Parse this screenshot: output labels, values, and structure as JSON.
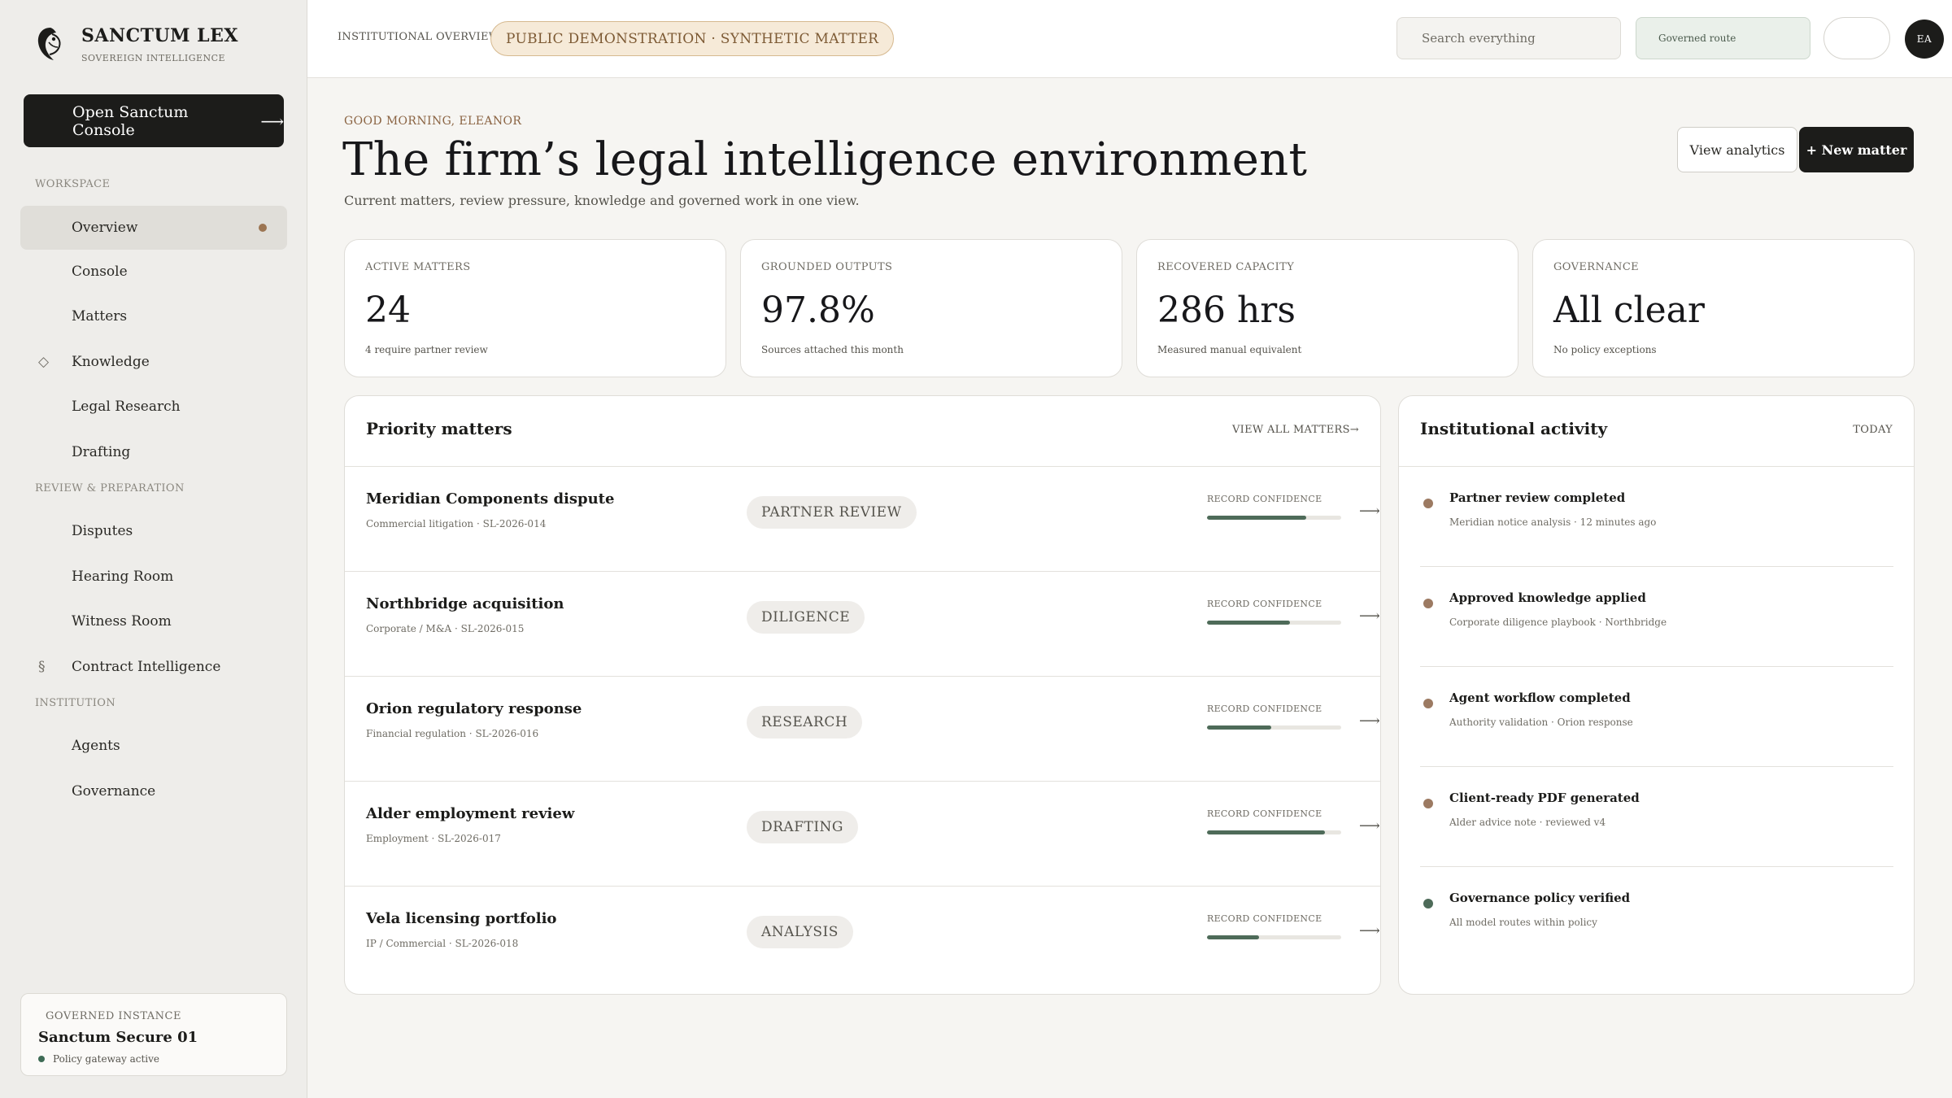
{
  "brand": {
    "name": "SANCTUM LEX",
    "tagline": "SOVEREIGN INTELLIGENCE"
  },
  "console_button": {
    "label": "Open Sanctum Console",
    "icon": "arrow-right-icon"
  },
  "sidebar": {
    "sections": [
      {
        "label": "WORKSPACE"
      },
      {
        "label": "REVIEW & PREPARATION"
      },
      {
        "label": "INSTITUTION"
      }
    ],
    "items": [
      {
        "label": "Overview",
        "active": true
      },
      {
        "label": "Console"
      },
      {
        "label": "Matters"
      },
      {
        "label": "Knowledge",
        "icon": "diamond-icon",
        "glyph": "◇"
      },
      {
        "label": "Legal Research"
      },
      {
        "label": "Drafting"
      },
      {
        "label": "Disputes"
      },
      {
        "label": "Hearing Room"
      },
      {
        "label": "Witness Room"
      },
      {
        "label": "Contract Intelligence",
        "icon": "section-sign-icon",
        "glyph": "§"
      },
      {
        "label": "Agents"
      },
      {
        "label": "Governance"
      }
    ]
  },
  "instance": {
    "label": "GOVERNED INSTANCE",
    "name": "Sanctum Secure 01",
    "status": "Policy gateway active"
  },
  "topbar": {
    "breadcrumb": "INSTITUTIONAL OVERVIEW",
    "demo_pill": "PUBLIC DEMONSTRATION · SYNTHETIC MATTER",
    "search_placeholder": "Search everything",
    "route_label": "Governed route",
    "avatar_initials": "EA"
  },
  "header": {
    "greeting": "GOOD MORNING, ELEANOR",
    "title": "The firm’s legal intelligence environment",
    "subtitle": "Current matters, review pressure, knowledge and governed work in one view.",
    "analytics_button": "View analytics",
    "new_matter_button": "+ New matter"
  },
  "stats": [
    {
      "label": "ACTIVE MATTERS",
      "value": "24",
      "note": "4 require partner review"
    },
    {
      "label": "GROUNDED OUTPUTS",
      "value": "97.8%",
      "note": "Sources attached this month"
    },
    {
      "label": "RECOVERED CAPACITY",
      "value": "286 hrs",
      "note": "Measured manual equivalent"
    },
    {
      "label": "GOVERNANCE",
      "value": "All clear",
      "note": "No policy exceptions"
    }
  ],
  "priority": {
    "title": "Priority matters",
    "link": "VIEW ALL MATTERS→",
    "confidence_label": "RECORD CONFIDENCE",
    "matters": [
      {
        "name": "Meridian Components dispute",
        "meta": "Commercial litigation · SL-2026-014",
        "status": "PARTNER REVIEW",
        "confidence": 0.74
      },
      {
        "name": "Northbridge acquisition",
        "meta": "Corporate / M&A · SL-2026-015",
        "status": "DILIGENCE",
        "confidence": 0.62
      },
      {
        "name": "Orion regulatory response",
        "meta": "Financial regulation · SL-2026-016",
        "status": "RESEARCH",
        "confidence": 0.48
      },
      {
        "name": "Alder employment review",
        "meta": "Employment · SL-2026-017",
        "status": "DRAFTING",
        "confidence": 0.88
      },
      {
        "name": "Vela licensing portfolio",
        "meta": "IP / Commercial · SL-2026-018",
        "status": "ANALYSIS",
        "confidence": 0.39
      }
    ]
  },
  "activity": {
    "title": "Institutional activity",
    "period": "TODAY",
    "items": [
      {
        "title": "Partner review completed",
        "meta": "Meridian notice analysis · 12 minutes ago",
        "color": "#9c7a62"
      },
      {
        "title": "Approved knowledge applied",
        "meta": "Corporate diligence playbook · Northbridge",
        "color": "#9c7a62"
      },
      {
        "title": "Agent workflow completed",
        "meta": "Authority validation · Orion response",
        "color": "#9c7a62"
      },
      {
        "title": "Client-ready PDF generated",
        "meta": "Alder advice note · reviewed v4",
        "color": "#9c7a62"
      },
      {
        "title": "Governance policy verified",
        "meta": "All model routes within policy",
        "color": "#4e6b59"
      }
    ]
  },
  "colors": {
    "accent": "#9c7552",
    "dark": "#1c1c1a",
    "confidence_fill": "#4e6b59"
  }
}
